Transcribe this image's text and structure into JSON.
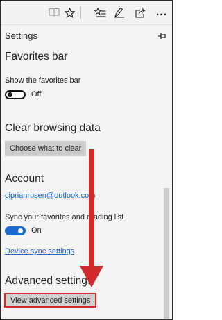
{
  "toolbar": {
    "icons": [
      "reading-view-icon",
      "favorite-star-icon",
      "favorites-list-icon",
      "pen-note-icon",
      "share-icon",
      "more-icon"
    ],
    "more_label": "..."
  },
  "panel": {
    "title": "Settings",
    "pin_icon": "pin-icon"
  },
  "favorites_bar": {
    "heading": "Favorites bar",
    "toggle_label": "Show the favorites bar",
    "toggle_state": "Off"
  },
  "clear_browsing": {
    "heading": "Clear browsing data",
    "button_label": "Choose what to clear"
  },
  "account": {
    "heading": "Account",
    "email": "ciprianrusen@outlook.com",
    "sync_label": "Sync your favorites and reading list",
    "sync_state": "On",
    "device_sync_link": "Device sync settings"
  },
  "advanced": {
    "heading": "Advanced settings",
    "button_label": "View advanced settings"
  },
  "colors": {
    "accent_blue": "#1b6bd0",
    "highlight_red": "#d12b2b"
  }
}
